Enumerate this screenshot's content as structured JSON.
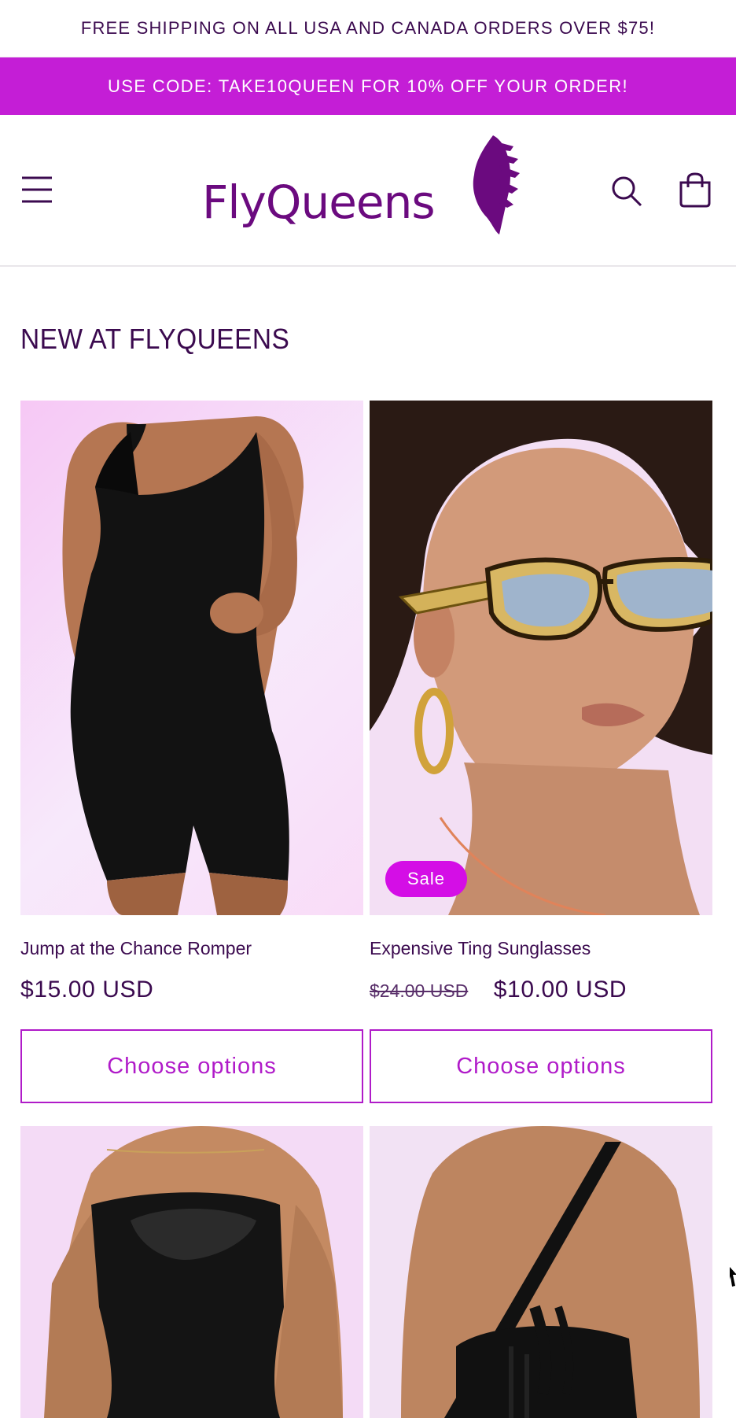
{
  "announcement": {
    "shipping": "FREE SHIPPING ON ALL USA AND CANADA ORDERS OVER $75!",
    "promo": "USE CODE: TAKE10QUEEN FOR 10% OFF YOUR ORDER!"
  },
  "header": {
    "logo_text": "FlyQueens",
    "menu_icon": "menu-icon",
    "search_icon": "search-icon",
    "cart_icon": "cart-icon"
  },
  "section": {
    "title": "NEW AT FLYQUEENS"
  },
  "products": [
    {
      "title": "Jump at the Chance Romper",
      "price": "$15.00 USD",
      "button": "Choose options"
    },
    {
      "title": "Expensive Ting Sunglasses",
      "price_old": "$24.00 USD",
      "price": "$10.00 USD",
      "badge": "Sale",
      "button": "Choose options"
    }
  ],
  "colors": {
    "brand_purple": "#3b0a4f",
    "promo_bar": "#c41ed6",
    "button_accent": "#b01bc9",
    "sale_badge": "#d40ee6"
  }
}
